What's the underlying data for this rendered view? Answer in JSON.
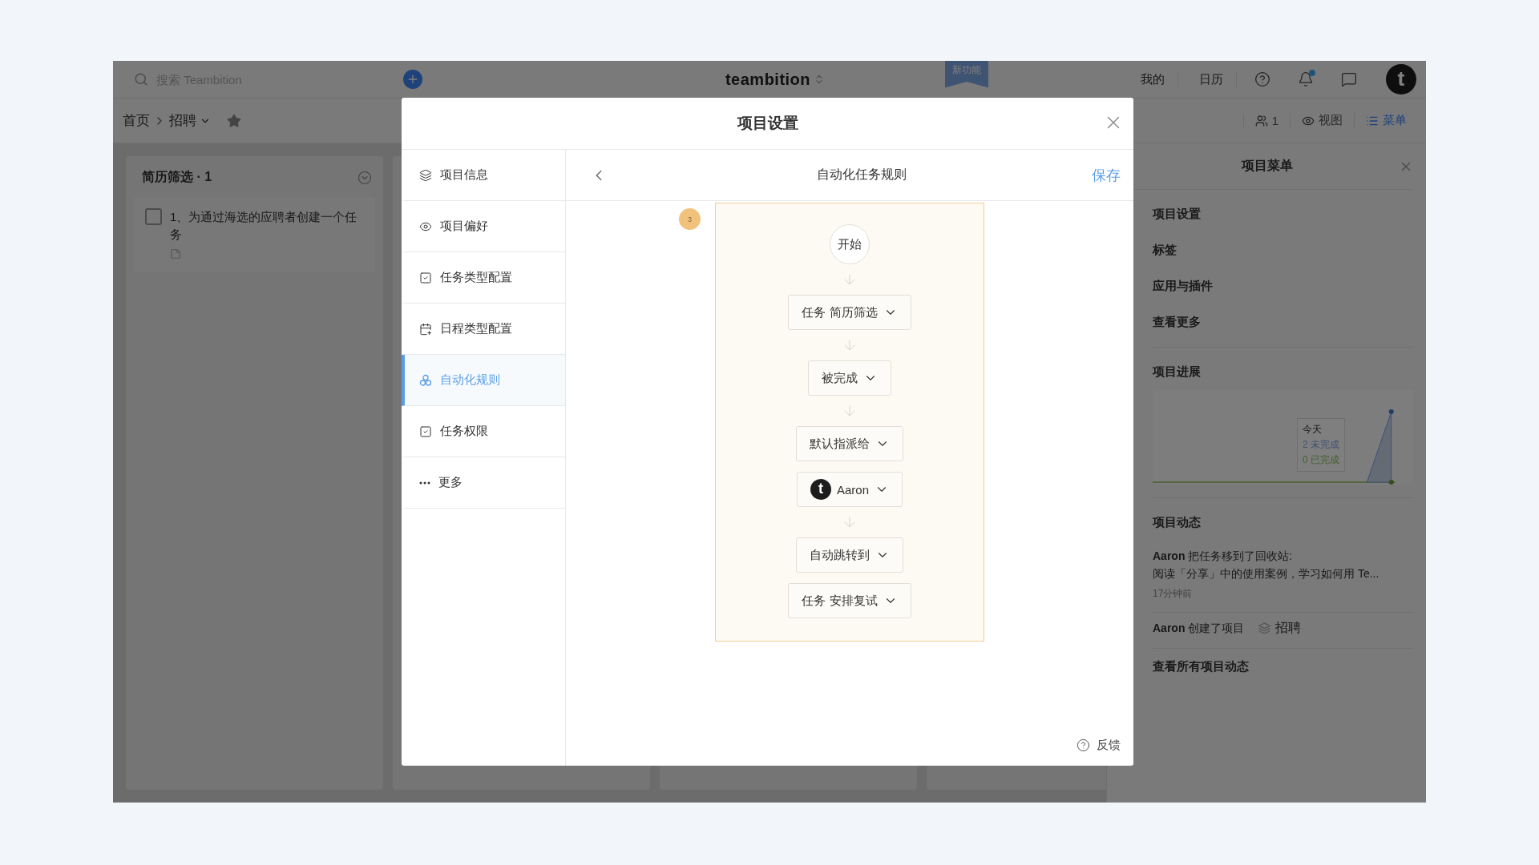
{
  "topbar": {
    "search": {
      "placeholder": "搜索 Teambition"
    },
    "brand": "teambition",
    "new_feature": "新功能",
    "links": [
      "我的",
      "日历"
    ],
    "notification_dot": true,
    "avatar_letter": "t"
  },
  "breadcrumb": {
    "items": [
      "首页",
      "招聘"
    ],
    "starred": true
  },
  "toolbar": [
    {
      "kind": "members",
      "label": "1",
      "selected": false
    },
    {
      "kind": "view",
      "label": "视图",
      "selected": false
    },
    {
      "kind": "menu",
      "label": "菜单",
      "selected": true
    }
  ],
  "board": {
    "columns": [
      {
        "title": "简历筛选 · 1",
        "tasks": [
          {
            "title": "1、为通过海选的应聘者创建一个任务",
            "checked": false
          }
        ]
      },
      {},
      {},
      {}
    ]
  },
  "project_menu": {
    "title": "项目菜单",
    "items": [
      "项目设置",
      "标签",
      "应用与插件",
      "查看更多"
    ],
    "progress": {
      "title": "项目进展",
      "tooltip": {
        "date": "今天",
        "open": "2 未完成",
        "done": "0 已完成"
      }
    },
    "activity": {
      "title": "项目动态",
      "entries": [
        {
          "kind": "moved",
          "text": "**Aaron** 把任务移到了回收站:",
          "detail": "阅读「分享」中的使用案例，学习如何用 Te...",
          "time": "17分钟前"
        },
        {
          "kind": "created",
          "text": "**Aaron** 创建了项目",
          "project": "招聘"
        }
      ],
      "all_link": "查看所有项目动态"
    }
  },
  "modal": {
    "title": "项目设置",
    "sidebar": [
      {
        "kind": "layers",
        "label": "项目信息",
        "selected": false
      },
      {
        "kind": "eye",
        "label": "项目偏好",
        "selected": false
      },
      {
        "kind": "task-type",
        "label": "任务类型配置",
        "selected": false
      },
      {
        "kind": "calendar",
        "label": "日程类型配置",
        "selected": false
      },
      {
        "kind": "automation",
        "label": "自动化规则",
        "selected": true
      },
      {
        "kind": "permission",
        "label": "任务权限",
        "selected": false
      },
      {
        "kind": "more",
        "label": "更多",
        "selected": false
      }
    ],
    "header": {
      "title": "自动化任务规则",
      "save": "保存"
    },
    "badge": "3",
    "flow": [
      {
        "kind": "start",
        "label": "开始",
        "arrow": false
      },
      {
        "kind": "select",
        "label": "任务 简历筛选",
        "arrow": true
      },
      {
        "kind": "select",
        "label": "被完成",
        "arrow": true
      },
      {
        "kind": "select",
        "label": "默认指派给",
        "arrow": true
      },
      {
        "kind": "user",
        "label": "Aaron",
        "avatar_letter": "t",
        "arrow": false
      },
      {
        "kind": "select",
        "label": "自动跳转到",
        "arrow": true
      },
      {
        "kind": "select",
        "label": "任务 安排复试",
        "arrow": false
      }
    ],
    "feedback": "反馈"
  }
}
